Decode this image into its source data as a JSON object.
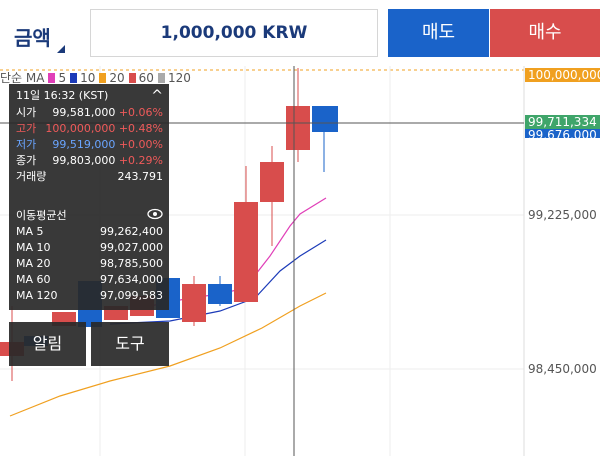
{
  "header": {
    "amount_label": "금액",
    "amount_value": "1,000,000 KRW",
    "sell_label": "매도",
    "buy_label": "매수"
  },
  "colors": {
    "sell": "#1a63c9",
    "buy": "#d84d4c",
    "ma5": "#e03fb8",
    "ma10": "#1c3bb8",
    "ma20": "#f0a020",
    "ma60": "#d84d4c",
    "ma120": "#aaaaaa"
  },
  "legend": {
    "prefix": "단순 MA",
    "items": [
      {
        "label": "5",
        "color": "#e03fb8"
      },
      {
        "label": "10",
        "color": "#1c3bb8"
      },
      {
        "label": "20",
        "color": "#f0a020"
      },
      {
        "label": "60",
        "color": "#d84d4c"
      },
      {
        "label": "120",
        "color": "#aaaaaa"
      }
    ]
  },
  "price_axis": {
    "top_label": "100,000,000",
    "current_label": "99,711,334",
    "partial_label": "99,676,000",
    "mid_label": "99,225,000",
    "low_label": "98,450,000"
  },
  "info": {
    "time": "11일 16:32 (KST)",
    "open_k": "시가",
    "open_v": "99,581,000",
    "open_c": "+0.06%",
    "high_k": "고가",
    "high_v": "100,000,000",
    "high_c": "+0.48%",
    "low_k": "저가",
    "low_v": "99,519,000",
    "low_c": "+0.00%",
    "close_k": "종가",
    "close_v": "99,803,000",
    "close_c": "+0.29%",
    "volume_k": "거래량",
    "volume_v": "243.791",
    "ma_title": "이동평균선",
    "ma5_k": "MA 5",
    "ma5_v": "99,262,400",
    "ma10_k": "MA 10",
    "ma10_v": "99,027,000",
    "ma20_k": "MA 20",
    "ma20_v": "98,785,500",
    "ma60_k": "MA 60",
    "ma60_v": "97,634,000",
    "ma120_k": "MA 120",
    "ma120_v": "97,099,583"
  },
  "buttons": {
    "alert_label": "알림",
    "tools_label": "도구"
  }
}
